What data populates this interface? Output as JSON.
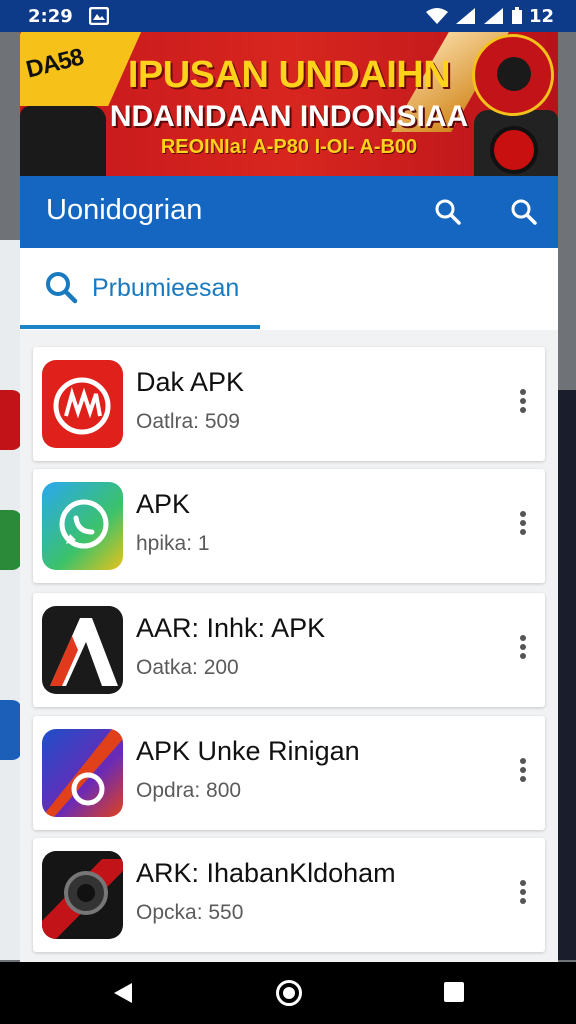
{
  "status_bar": {
    "time": "2:29",
    "battery_text": "12"
  },
  "banner": {
    "corner_text": "DA58",
    "line1": "IPUSAN UNDAIHN",
    "line2": "NDAINDAAN INDONSIAA",
    "line3": "REOINIa! A-P80 I-OI- A-B00",
    "colors": {
      "background": "#c4161c",
      "accent": "#ffd21c"
    }
  },
  "appbar": {
    "title": "Uonidogrian",
    "accent": "#1466c0"
  },
  "search": {
    "text": "Prbumieesan"
  },
  "apps": [
    {
      "name": "Dak APK",
      "sub": "Oatlra: 509",
      "icon": "red-app-icon"
    },
    {
      "name": "APK",
      "sub": "hpika: 1",
      "icon": "whatsapp-icon"
    },
    {
      "name": "AAR: Inhk: APK",
      "sub": "Oatka: 200",
      "icon": "letter-a-icon"
    },
    {
      "name": "APK Unke Rinigan",
      "sub": "Opdra: 800",
      "icon": "nokia-app-icon"
    },
    {
      "name": "ARK: IhabanKldoham",
      "sub": "Opcka: 550",
      "icon": "camera-app-icon"
    }
  ]
}
